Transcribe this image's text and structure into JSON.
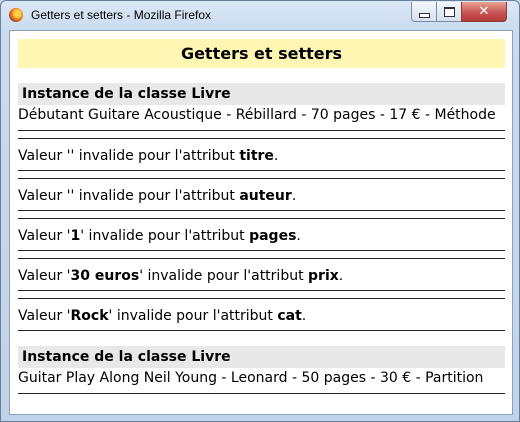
{
  "window": {
    "title": "Getters et setters - Mozilla Firefox",
    "close_symbol": "✕"
  },
  "page": {
    "title": "Getters et setters",
    "sections": [
      {
        "heading": "Instance de la classe Livre",
        "summary": "Débutant Guitare Acoustique - Rébillard - 70 pages - 17 € - Méthode",
        "errors": [
          {
            "prefix": "Valeur '",
            "value": "",
            "middle": "' invalide pour l'attribut ",
            "attr": "titre",
            "suffix": "."
          },
          {
            "prefix": "Valeur '",
            "value": "",
            "middle": "' invalide pour l'attribut ",
            "attr": "auteur",
            "suffix": "."
          },
          {
            "prefix": "Valeur '",
            "value": "1",
            "middle": "' invalide pour l'attribut ",
            "attr": "pages",
            "suffix": "."
          },
          {
            "prefix": "Valeur '",
            "value": "30 euros",
            "middle": "' invalide pour l'attribut ",
            "attr": "prix",
            "suffix": "."
          },
          {
            "prefix": "Valeur '",
            "value": "Rock",
            "middle": "' invalide pour l'attribut ",
            "attr": "cat",
            "suffix": "."
          }
        ]
      },
      {
        "heading": "Instance de la classe Livre",
        "summary": "Guitar Play Along Neil Young - Leonard - 50 pages - 30 € - Partition"
      }
    ]
  }
}
